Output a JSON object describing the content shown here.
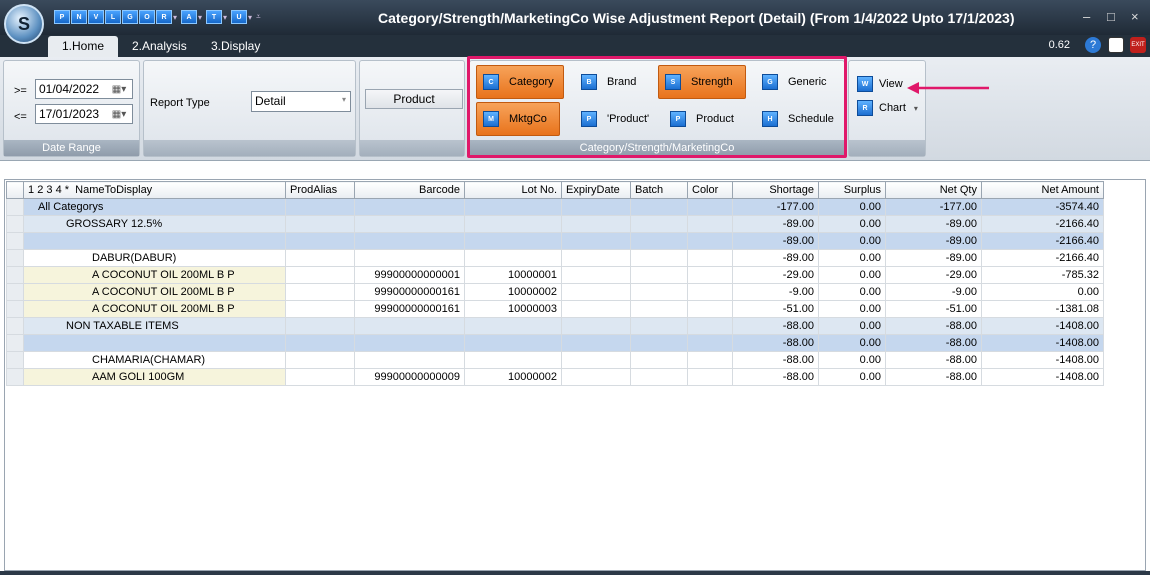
{
  "app": {
    "title": "Category/Strength/MarketingCo Wise Adjustment Report (Detail)  (From 1/4/2022 Upto 17/1/2023)",
    "logo_letter": "S",
    "quick_access": [
      "P",
      "N",
      "V",
      "L",
      "G",
      "O",
      "R",
      "A",
      "T",
      "U"
    ],
    "window_controls": {
      "minimize": "–",
      "maximize": "□",
      "close": "×"
    }
  },
  "tabs": [
    {
      "label": "1.Home",
      "active": true
    },
    {
      "label": "2.Analysis",
      "active": false
    },
    {
      "label": "3.Display",
      "active": false
    }
  ],
  "zoom": "0.62",
  "date_range": {
    "from_label": ">=",
    "from_value": "01/04/2022",
    "to_label": "<=",
    "to_value": "17/01/2023",
    "group_label": "Date Range"
  },
  "report_type": {
    "label": "Report Type",
    "value": "Detail"
  },
  "product_button": "Product",
  "grouping": {
    "group_label": "Category/Strength/MarketingCo",
    "buttons": [
      {
        "label": "Category",
        "icon": "C",
        "on": true
      },
      {
        "label": "Brand",
        "icon": "B",
        "on": false
      },
      {
        "label": "Strength",
        "icon": "S",
        "on": true
      },
      {
        "label": "Generic",
        "icon": "G",
        "on": false
      },
      {
        "label": "MktgCo",
        "icon": "M",
        "on": true
      },
      {
        "label": "'Product'",
        "icon": "P",
        "on": false
      },
      {
        "label": "Product",
        "icon": "P",
        "on": false
      },
      {
        "label": "Schedule",
        "icon": "H",
        "on": false
      }
    ]
  },
  "actions": {
    "view_label": "View",
    "chart_label": "Chart"
  },
  "grid": {
    "level_buttons": [
      "1",
      "2",
      "3",
      "4",
      "*"
    ],
    "columns": [
      "NameToDisplay",
      "ProdAlias",
      "Barcode",
      "Lot No.",
      "ExpiryDate",
      "Batch",
      "Color",
      "Shortage",
      "Surplus",
      "Net Qty",
      "Net Amount"
    ],
    "rows": [
      {
        "type": "cat",
        "name": "All Categorys",
        "alias": "",
        "barcode": "",
        "lot": "",
        "expiry": "",
        "batch": "",
        "color": "",
        "shortage": "-177.00",
        "surplus": "0.00",
        "netqty": "-177.00",
        "netamount": "-3574.40"
      },
      {
        "type": "sub",
        "name": "GROSSARY 12.5%",
        "alias": "",
        "barcode": "",
        "lot": "",
        "expiry": "",
        "batch": "",
        "color": "",
        "shortage": "-89.00",
        "surplus": "0.00",
        "netqty": "-89.00",
        "netamount": "-2166.40"
      },
      {
        "type": "blank",
        "name": "",
        "alias": "",
        "barcode": "",
        "lot": "",
        "expiry": "",
        "batch": "",
        "color": "",
        "shortage": "-89.00",
        "surplus": "0.00",
        "netqty": "-89.00",
        "netamount": "-2166.40"
      },
      {
        "type": "mfg",
        "name": "DABUR(DABUR)",
        "alias": "",
        "barcode": "",
        "lot": "",
        "expiry": "",
        "batch": "",
        "color": "",
        "shortage": "-89.00",
        "surplus": "0.00",
        "netqty": "-89.00",
        "netamount": "-2166.40"
      },
      {
        "type": "item",
        "name": "A COCONUT OIL 200ML B P",
        "alias": "",
        "barcode": "99900000000001",
        "lot": "10000001",
        "expiry": "",
        "batch": "",
        "color": "",
        "shortage": "-29.00",
        "surplus": "0.00",
        "netqty": "-29.00",
        "netamount": "-785.32"
      },
      {
        "type": "item",
        "name": "A COCONUT OIL 200ML B P",
        "alias": "",
        "barcode": "99900000000161",
        "lot": "10000002",
        "expiry": "",
        "batch": "",
        "color": "",
        "shortage": "-9.00",
        "surplus": "0.00",
        "netqty": "-9.00",
        "netamount": "0.00"
      },
      {
        "type": "item",
        "name": "A COCONUT OIL 200ML B P",
        "alias": "",
        "barcode": "99900000000161",
        "lot": "10000003",
        "expiry": "",
        "batch": "",
        "color": "",
        "shortage": "-51.00",
        "surplus": "0.00",
        "netqty": "-51.00",
        "netamount": "-1381.08"
      },
      {
        "type": "sub",
        "name": "NON TAXABLE ITEMS",
        "alias": "",
        "barcode": "",
        "lot": "",
        "expiry": "",
        "batch": "",
        "color": "",
        "shortage": "-88.00",
        "surplus": "0.00",
        "netqty": "-88.00",
        "netamount": "-1408.00"
      },
      {
        "type": "blank",
        "name": "",
        "alias": "",
        "barcode": "",
        "lot": "",
        "expiry": "",
        "batch": "",
        "color": "",
        "shortage": "-88.00",
        "surplus": "0.00",
        "netqty": "-88.00",
        "netamount": "-1408.00"
      },
      {
        "type": "mfg",
        "name": "CHAMARIA(CHAMAR)",
        "alias": "",
        "barcode": "",
        "lot": "",
        "expiry": "",
        "batch": "",
        "color": "",
        "shortage": "-88.00",
        "surplus": "0.00",
        "netqty": "-88.00",
        "netamount": "-1408.00"
      },
      {
        "type": "item",
        "name": "AAM GOLI 100GM",
        "alias": "",
        "barcode": "99900000000009",
        "lot": "10000002",
        "expiry": "",
        "batch": "",
        "color": "",
        "shortage": "-88.00",
        "surplus": "0.00",
        "netqty": "-88.00",
        "netamount": "-1408.00"
      }
    ]
  },
  "colors": {
    "highlight": "#e0186a",
    "toggle_on": "#e8731c",
    "row_category": "#c5d7ee",
    "row_item_name": "#f6f4dc"
  }
}
